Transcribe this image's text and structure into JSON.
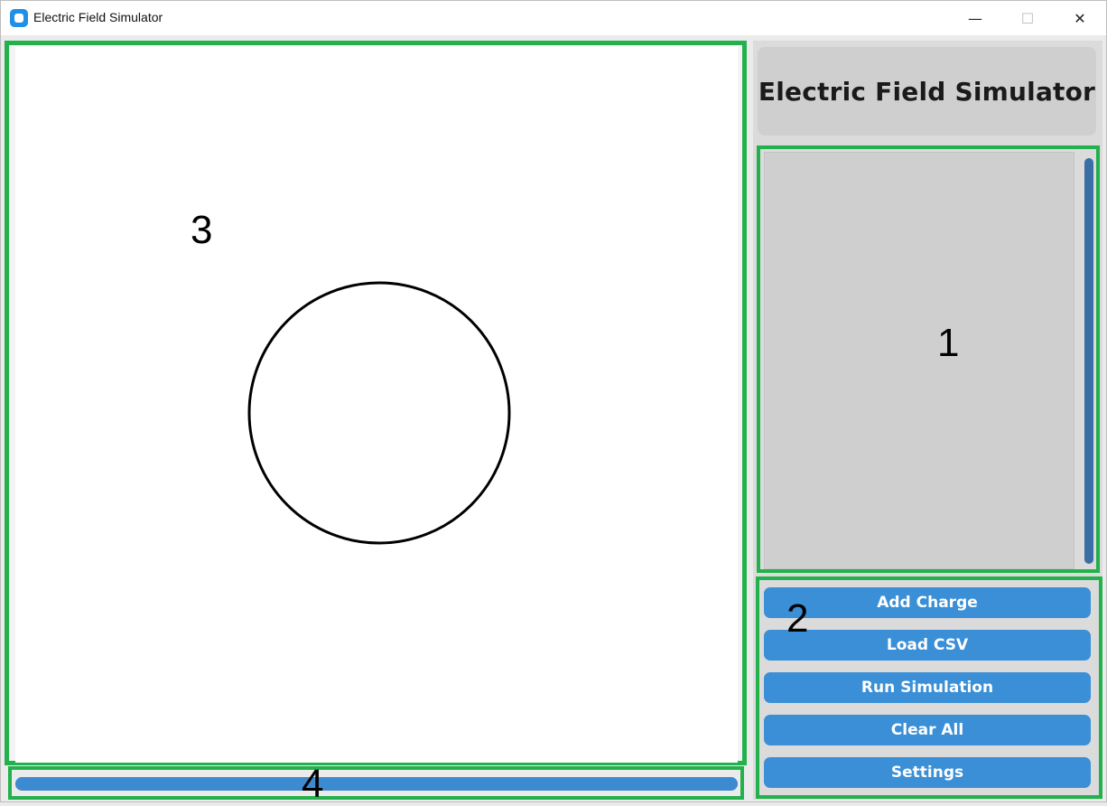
{
  "window": {
    "title": "Electric Field Simulator",
    "controls": {
      "minimize": "—",
      "maximize": "☐",
      "close": "✕"
    }
  },
  "sidebar": {
    "heading": "Electric Field Simulator",
    "charge_list": {
      "items": []
    },
    "buttons": [
      {
        "label": "Add Charge"
      },
      {
        "label": "Load CSV"
      },
      {
        "label": "Run Simulation"
      },
      {
        "label": "Clear All"
      },
      {
        "label": "Settings"
      }
    ]
  },
  "progress": {
    "value": 1.0
  },
  "annotations": {
    "region_1": "1",
    "region_2": "2",
    "region_3": "3",
    "region_4": "4"
  },
  "colors": {
    "annotation_border": "#22b14c",
    "button": "#3a8fd6",
    "scrollbar": "#3a6ea5",
    "panel": "#cfcfcf"
  },
  "icons": {
    "app": "app-window-icon"
  }
}
